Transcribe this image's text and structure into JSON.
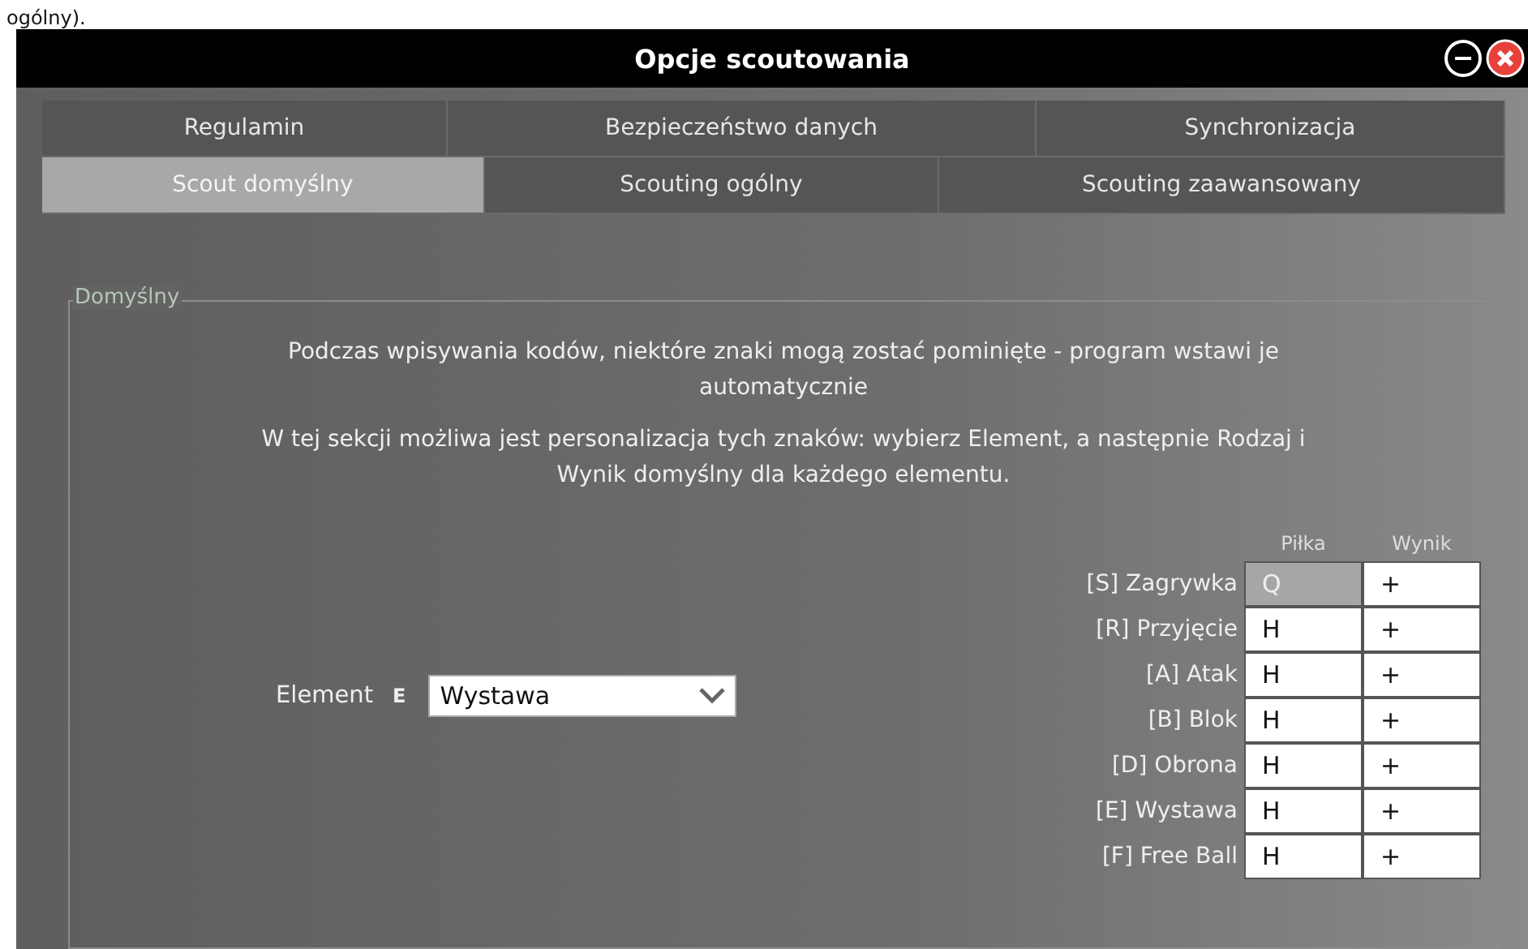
{
  "page_text_above": "ogólny).",
  "window": {
    "title": "Opcje scoutowania"
  },
  "tab_rows": [
    {
      "tabs": [
        {
          "label": "Regulamin",
          "selected": false
        },
        {
          "label": "Bezpieczeństwo danych",
          "selected": false
        },
        {
          "label": "Synchronizacja",
          "selected": false
        }
      ]
    },
    {
      "tabs": [
        {
          "label": "Scout domyślny",
          "selected": true
        },
        {
          "label": "Scouting ogólny",
          "selected": false
        },
        {
          "label": "Scouting zaawansowany",
          "selected": false
        }
      ]
    }
  ],
  "group": {
    "legend": "Domyślny",
    "paragraphs": [
      "Podczas wpisywania kodów, niektóre znaki mogą zostać pominięte - program wstawi je automatycznie",
      "W tej sekcji możliwa jest personalizacja tych znaków: wybierz Element, a następnie Rodzaj i Wynik domyślny dla każdego elementu."
    ],
    "element_label": "Element",
    "element_shortcut": "E",
    "element_value": "Wystawa",
    "table": {
      "columns": [
        "Piłka",
        "Wynik"
      ],
      "rows": [
        {
          "label": "[S] Zagrywka",
          "ball": "Q",
          "result": "+",
          "selected": true
        },
        {
          "label": "[R] Przyjęcie",
          "ball": "H",
          "result": "+",
          "selected": false
        },
        {
          "label": "[A] Atak",
          "ball": "H",
          "result": "+",
          "selected": false
        },
        {
          "label": "[B] Blok",
          "ball": "H",
          "result": "+",
          "selected": false
        },
        {
          "label": "[D] Obrona",
          "ball": "H",
          "result": "+",
          "selected": false
        },
        {
          "label": "[E] Wystawa",
          "ball": "H",
          "result": "+",
          "selected": false
        },
        {
          "label": "[F] Free Ball",
          "ball": "H",
          "result": "+",
          "selected": false
        }
      ]
    }
  }
}
